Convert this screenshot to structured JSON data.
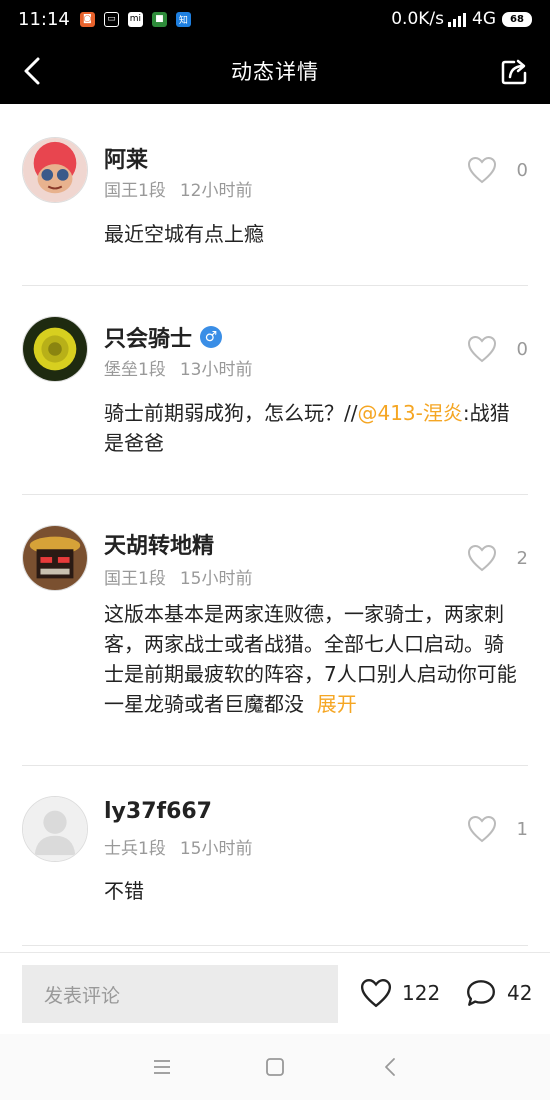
{
  "status_bar": {
    "time": "11:14",
    "speed": "0.0K/s",
    "network": "4G",
    "battery": "68",
    "notification_icons": [
      "app-icon-orange",
      "app-icon-box",
      "mi-icon",
      "app-icon-green",
      "zhihu-icon"
    ]
  },
  "nav": {
    "title": "动态详情"
  },
  "comments": [
    {
      "name": "阿莱",
      "rank": "国王1段",
      "time": "12小时前",
      "likes": "0",
      "text": "最近空城有点上瘾"
    },
    {
      "name": "只会骑士",
      "gender": "♂",
      "rank": "堡垒1段",
      "time": "13小时前",
      "likes": "0",
      "text_before": "骑士前期弱成狗，怎么玩？//",
      "mention": "@413-涅炎",
      "text_after": ":战猎是爸爸"
    },
    {
      "name": "天胡转地精",
      "rank": "国王1段",
      "time": "15小时前",
      "likes": "2",
      "text": "这版本基本是两家连败德，一家骑士，两家刺客，两家战士或者战猎。全部七人口启动。骑士是前期最疲软的阵容，7人口别人启动你可能一星龙骑或者巨魔都没",
      "expand": "展开"
    },
    {
      "name": "ly37f667",
      "rank": "士兵1段",
      "time": "15小时前",
      "likes": "1",
      "text": "不错"
    }
  ],
  "bottom_bar": {
    "placeholder": "发表评论",
    "likes": "122",
    "comments": "42"
  },
  "colors": {
    "accent": "#f5a623",
    "gender": "#3a8ee6",
    "muted": "#999999"
  }
}
